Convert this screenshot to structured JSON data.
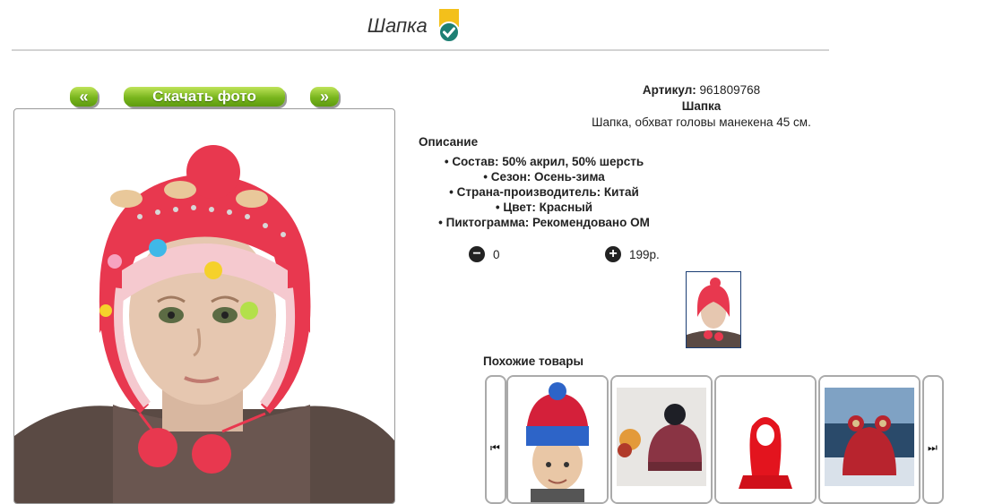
{
  "header": {
    "title": "Шапка"
  },
  "toolbar": {
    "prev_label": "«",
    "download_label": "Скачать фото",
    "next_label": "»"
  },
  "product": {
    "article_label": "Артикул:",
    "article_value": "961809768",
    "name": "Шапка",
    "short_desc": "Шапка, обхват головы манекена 45 см."
  },
  "description": {
    "title": "Описание",
    "items": [
      "Состав: 50% акрил, 50% шерсть",
      "Сезон: Осень-зима",
      "Страна-производитель: Китай",
      "Цвет: Красный",
      "Пиктограмма: Рекомендовано ОМ"
    ]
  },
  "cart": {
    "quantity": "0",
    "price": "199р."
  },
  "similar": {
    "title": "Похожие товары"
  },
  "colors": {
    "accent_green": "#78b51d",
    "thumb_border": "#1a3d73",
    "hat_red": "#e8384f"
  }
}
